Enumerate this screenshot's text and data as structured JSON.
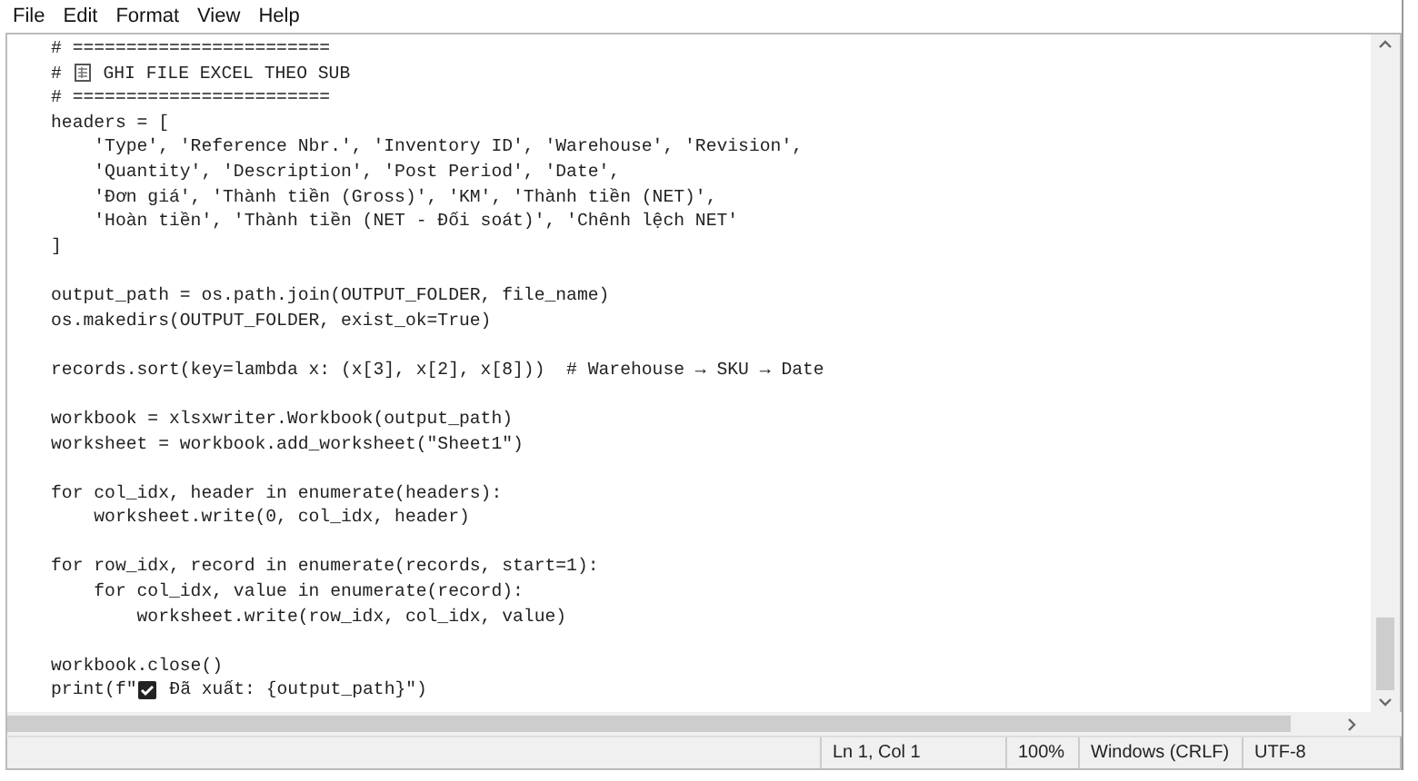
{
  "menu": [
    "File",
    "Edit",
    "Format",
    "View",
    "Help"
  ],
  "lines": [
    {
      "kind": "text",
      "text": "# ========================"
    },
    {
      "kind": "sheet",
      "prefix": "# ",
      "text": " GHI FILE EXCEL THEO SUB"
    },
    {
      "kind": "text",
      "text": "# ========================"
    },
    {
      "kind": "text",
      "text": "headers = ["
    },
    {
      "kind": "text",
      "text": "    'Type', 'Reference Nbr.', 'Inventory ID', 'Warehouse', 'Revision',"
    },
    {
      "kind": "text",
      "text": "    'Quantity', 'Description', 'Post Period', 'Date',"
    },
    {
      "kind": "text",
      "text": "    'Đơn giá', 'Thành tiền (Gross)', 'KM', 'Thành tiền (NET)',"
    },
    {
      "kind": "text",
      "text": "    'Hoàn tiền', 'Thành tiền (NET - Đối soát)', 'Chênh lệch NET'"
    },
    {
      "kind": "text",
      "text": "]"
    },
    {
      "kind": "blank"
    },
    {
      "kind": "text",
      "text": "output_path = os.path.join(OUTPUT_FOLDER, file_name)"
    },
    {
      "kind": "text",
      "text": "os.makedirs(OUTPUT_FOLDER, exist_ok=True)"
    },
    {
      "kind": "blank"
    },
    {
      "kind": "text",
      "text": "records.sort(key=lambda x: (x[3], x[2], x[8]))  # Warehouse → SKU → Date"
    },
    {
      "kind": "blank"
    },
    {
      "kind": "text",
      "text": "workbook = xlsxwriter.Workbook(output_path)"
    },
    {
      "kind": "text",
      "text": "worksheet = workbook.add_worksheet(\"Sheet1\")"
    },
    {
      "kind": "blank"
    },
    {
      "kind": "text",
      "text": "for col_idx, header in enumerate(headers):"
    },
    {
      "kind": "text",
      "text": "    worksheet.write(0, col_idx, header)"
    },
    {
      "kind": "blank"
    },
    {
      "kind": "text",
      "text": "for row_idx, record in enumerate(records, start=1):"
    },
    {
      "kind": "text",
      "text": "    for col_idx, value in enumerate(record):"
    },
    {
      "kind": "text",
      "text": "        worksheet.write(row_idx, col_idx, value)"
    },
    {
      "kind": "blank"
    },
    {
      "kind": "text",
      "text": "workbook.close()"
    },
    {
      "kind": "check",
      "prefix": "print(f\"",
      "text": " Đã xuất: {output_path}\")"
    }
  ],
  "status_bar": {
    "position": "Ln 1, Col 1",
    "zoom": "100%",
    "line_endings": "Windows (CRLF)",
    "encoding": "UTF-8"
  }
}
